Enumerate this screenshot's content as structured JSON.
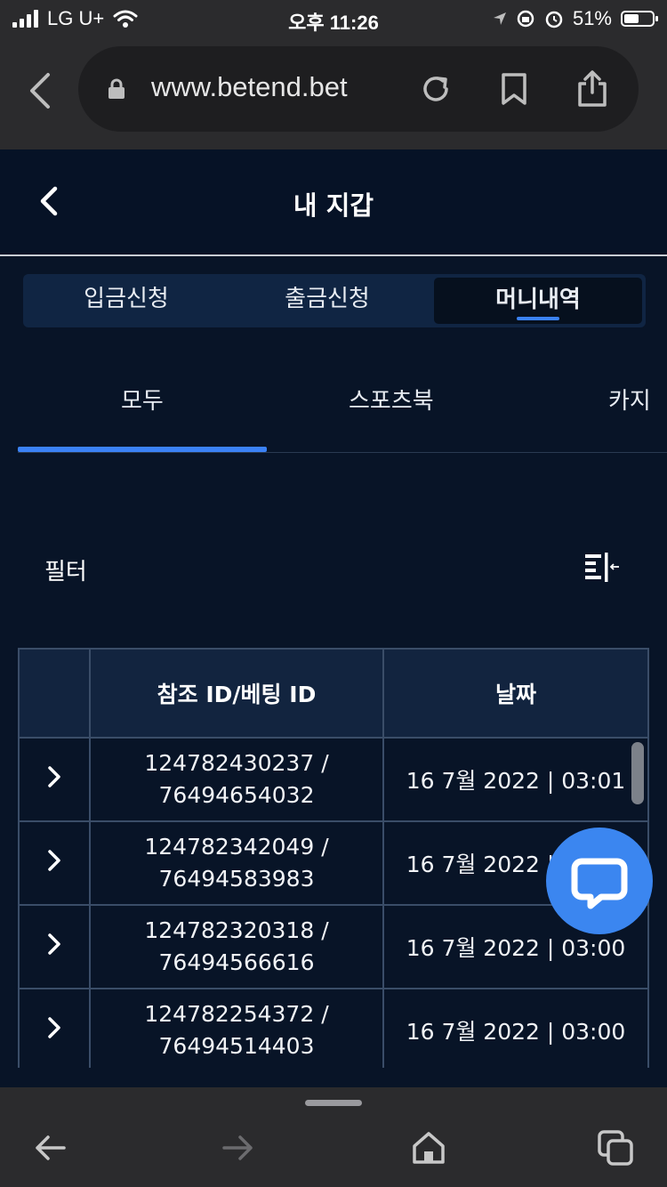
{
  "status_bar": {
    "carrier": "LG U+",
    "time": "오후 11:26",
    "battery": "51%"
  },
  "browser": {
    "url": "www.betend.bet"
  },
  "header": {
    "title": "내 지갑"
  },
  "segments": [
    {
      "label": "입금신청",
      "active": false
    },
    {
      "label": "출금신청",
      "active": false
    },
    {
      "label": "머니내역",
      "active": true
    }
  ],
  "subtabs": [
    {
      "label": "모두",
      "active": true
    },
    {
      "label": "스포츠북",
      "active": false
    },
    {
      "label": "카지",
      "active": false
    }
  ],
  "filter": {
    "label": "필터"
  },
  "table": {
    "headers": [
      "",
      "참조 ID/베팅 ID",
      "날짜"
    ],
    "rows": [
      {
        "ref_line1": "124782430237 /",
        "ref_line2": "76494654032",
        "date": "16 7월 2022 | 03:01"
      },
      {
        "ref_line1": "124782342049 /",
        "ref_line2": "76494583983",
        "date": "16 7월 2022 | 03:00"
      },
      {
        "ref_line1": "124782320318 /",
        "ref_line2": "76494566616",
        "date": "16 7월 2022 | 03:00"
      },
      {
        "ref_line1": "124782254372 /",
        "ref_line2": "76494514403",
        "date": "16 7월 2022 | 03:00"
      }
    ]
  },
  "colors": {
    "background": "#081427",
    "accent": "#3b82f6",
    "chat_button": "#3b86f0",
    "browser_chrome": "#2b2b2d"
  }
}
